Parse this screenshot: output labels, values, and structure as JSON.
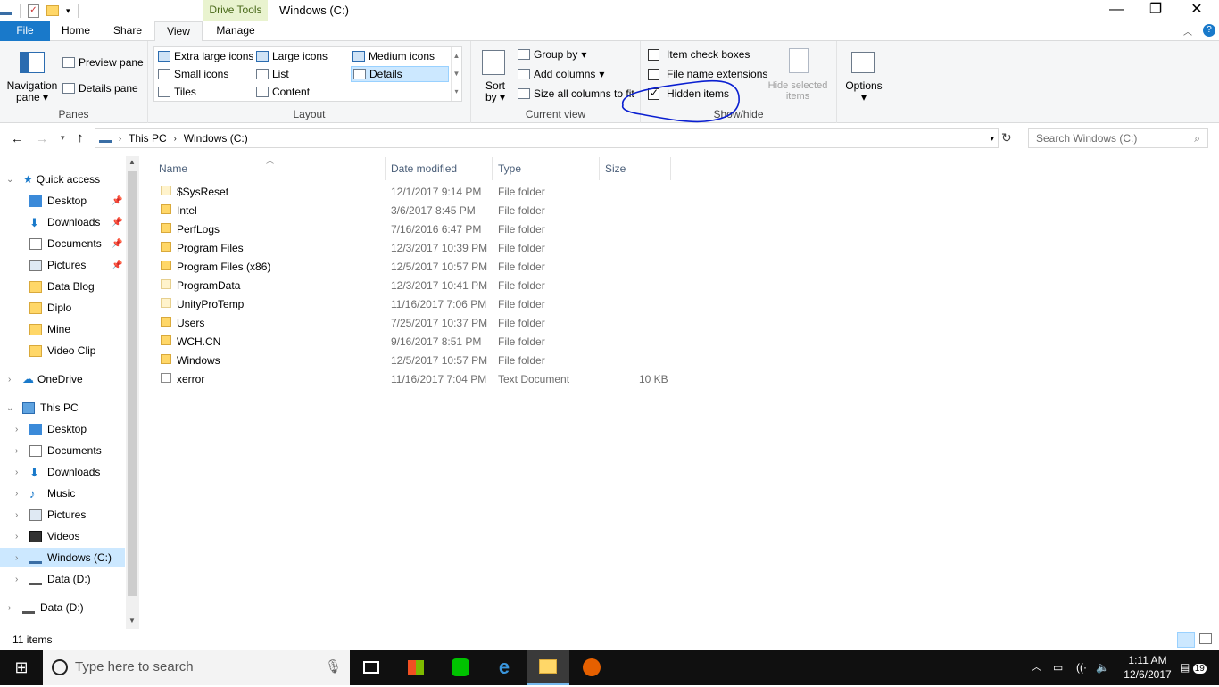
{
  "window": {
    "title": "Windows (C:)",
    "context_tab": "Drive Tools",
    "minimize": "—",
    "restore": "❐",
    "close": "✕"
  },
  "tabs": [
    {
      "label": "File"
    },
    {
      "label": "Home"
    },
    {
      "label": "Share"
    },
    {
      "label": "View"
    },
    {
      "label": "Manage"
    }
  ],
  "ribbon": {
    "panes": {
      "label": "Panes",
      "navigation_pane": "Navigation pane",
      "preview_pane": "Preview pane",
      "details_pane": "Details pane"
    },
    "layout": {
      "label": "Layout",
      "options": [
        "Extra large icons",
        "Large icons",
        "Medium icons",
        "Small icons",
        "List",
        "Details",
        "Tiles",
        "Content"
      ],
      "selected": "Details"
    },
    "current_view": {
      "label": "Current view",
      "sort_by": "Sort by",
      "group_by": "Group by",
      "add_columns": "Add columns",
      "size_all_columns": "Size all columns to fit"
    },
    "show_hide": {
      "label": "Show/hide",
      "item_check_boxes": "Item check boxes",
      "file_name_extensions": "File name extensions",
      "hidden_items": "Hidden items",
      "hide_selected_items": "Hide selected items"
    },
    "options": {
      "label": "Options"
    }
  },
  "address": {
    "path": [
      "This PC",
      "Windows (C:)"
    ],
    "search_placeholder": "Search Windows (C:)"
  },
  "nav": {
    "quick_access": "Quick access",
    "quick_items": [
      "Desktop",
      "Downloads",
      "Documents",
      "Pictures",
      "Data Blog",
      "Diplo",
      "Mine",
      "Video Clip"
    ],
    "onedrive": "OneDrive",
    "this_pc": "This PC",
    "pc_items": [
      "Desktop",
      "Documents",
      "Downloads",
      "Music",
      "Pictures",
      "Videos",
      "Windows (C:)",
      "Data (D:)"
    ],
    "data_d": "Data (D:)"
  },
  "columns": {
    "name": "Name",
    "date": "Date modified",
    "type": "Type",
    "size": "Size"
  },
  "files": [
    {
      "name": "$SysReset",
      "date": "12/1/2017 9:14 PM",
      "type": "File folder",
      "size": ""
    },
    {
      "name": "Intel",
      "date": "3/6/2017 8:45 PM",
      "type": "File folder",
      "size": ""
    },
    {
      "name": "PerfLogs",
      "date": "7/16/2016 6:47 PM",
      "type": "File folder",
      "size": ""
    },
    {
      "name": "Program Files",
      "date": "12/3/2017 10:39 PM",
      "type": "File folder",
      "size": ""
    },
    {
      "name": "Program Files (x86)",
      "date": "12/5/2017 10:57 PM",
      "type": "File folder",
      "size": ""
    },
    {
      "name": "ProgramData",
      "date": "12/3/2017 10:41 PM",
      "type": "File folder",
      "size": ""
    },
    {
      "name": "UnityProTemp",
      "date": "11/16/2017 7:06 PM",
      "type": "File folder",
      "size": ""
    },
    {
      "name": "Users",
      "date": "7/25/2017 10:37 PM",
      "type": "File folder",
      "size": ""
    },
    {
      "name": "WCH.CN",
      "date": "9/16/2017 8:51 PM",
      "type": "File folder",
      "size": ""
    },
    {
      "name": "Windows",
      "date": "12/5/2017 10:57 PM",
      "type": "File folder",
      "size": ""
    },
    {
      "name": "xerror",
      "date": "11/16/2017 7:04 PM",
      "type": "Text Document",
      "size": "10 KB"
    }
  ],
  "status": {
    "count": "11 items"
  },
  "taskbar": {
    "search_placeholder": "Type here to search",
    "time": "1:11 AM",
    "date": "12/6/2017",
    "notifications": "19"
  }
}
